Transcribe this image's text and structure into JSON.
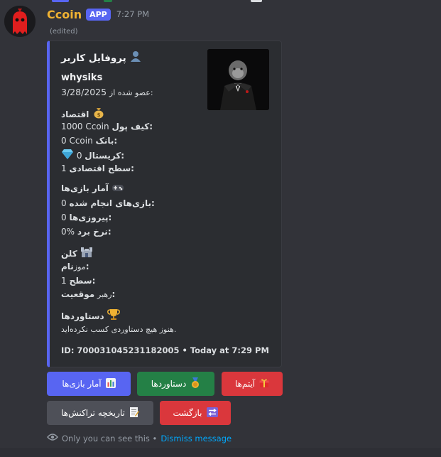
{
  "message": {
    "username": "Ccoin",
    "badge": "APP",
    "time": "7:27 PM",
    "edited": "(edited)"
  },
  "embed": {
    "title": "پروفایل کاربر",
    "username": "whysiks",
    "member_since_label": "عضو شده از:",
    "member_since_date": "3/28/2025",
    "economy": {
      "heading": "اقتصاد",
      "wallet_label": "کیف پول:",
      "wallet_value": "1000 Ccoin",
      "bank_label": "بانک:",
      "bank_value": "0 Ccoin",
      "crystal_label": "کریستال:",
      "crystal_value": "0",
      "level_label": "سطح اقتصادی:",
      "level_value": "1"
    },
    "games": {
      "heading": "آمار بازی‌ها",
      "played_label": "بازی‌های انجام شده:",
      "played_value": "0",
      "wins_label": "پیروزی‌ها:",
      "wins_value": "0",
      "winrate_label": "نرخ برد:",
      "winrate_value": "0%"
    },
    "clan": {
      "heading": "کلن",
      "name_label": "نام:",
      "name_value": "موز",
      "level_label": "سطح:",
      "level_value": "1",
      "position_label": "موقعیت:",
      "position_value": "رهبر"
    },
    "achievements": {
      "heading": "دستاوردها",
      "text": "هنوز هیچ دستاوردی کسب نکرده‌اید."
    },
    "footer": "ID: 700031045231182005 • Today at 7:29 PM"
  },
  "buttons": {
    "items": "آیتم‌ها",
    "achievements": "دستاوردها",
    "game_stats": "آمار بازی‌ها",
    "back": "بازگشت",
    "transactions": "تاریخچه تراکنش‌ها"
  },
  "ephemeral": {
    "note": "Only you can see this •",
    "dismiss": "Dismiss message"
  },
  "colors": {
    "accent": "#5865f2",
    "username": "#f0b232",
    "green_button": "#248046",
    "red_button": "#da373c",
    "gray_button": "#4e5058"
  }
}
